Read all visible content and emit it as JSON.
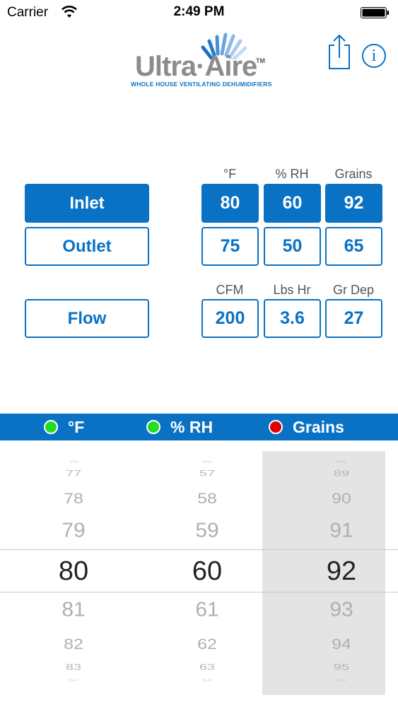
{
  "status_bar": {
    "carrier": "Carrier",
    "time": "2:49 PM"
  },
  "header": {
    "logo_name": "Ultra·Aire",
    "logo_tm": "TM",
    "logo_subtitle": "WHOLE HOUSE VENTILATING DEHUMIDIFIERS",
    "share_icon": "share-icon",
    "info_icon": "info-icon",
    "info_glyph": "i"
  },
  "air_columns": {
    "temp": "°F",
    "rh": "% RH",
    "grains": "Grains"
  },
  "flow_columns": {
    "cfm": "CFM",
    "lbs": "Lbs Hr",
    "grdep": "Gr Dep"
  },
  "inlet": {
    "label": "Inlet",
    "temp": "80",
    "rh": "60",
    "grains": "92"
  },
  "outlet": {
    "label": "Outlet",
    "temp": "75",
    "rh": "50",
    "grains": "65"
  },
  "flow": {
    "label": "Flow",
    "cfm": "200",
    "lbs": "3.6",
    "grdep": "27"
  },
  "picker_bar": {
    "items": [
      {
        "label": "°F",
        "status_color": "#22dd22"
      },
      {
        "label": "% RH",
        "status_color": "#22dd22"
      },
      {
        "label": "Grains",
        "status_color": "#e00000"
      }
    ]
  },
  "picker": {
    "temp": [
      "76",
      "77",
      "78",
      "79",
      "80",
      "81",
      "82",
      "83",
      "84"
    ],
    "rh": [
      "56",
      "57",
      "58",
      "59",
      "60",
      "61",
      "62",
      "63",
      "64"
    ],
    "grains": [
      "88",
      "89",
      "90",
      "91",
      "92",
      "93",
      "94",
      "95",
      "96"
    ],
    "selected_index": 4
  },
  "colors": {
    "accent": "#0a72c4",
    "highlight": "#e4e4e4"
  }
}
